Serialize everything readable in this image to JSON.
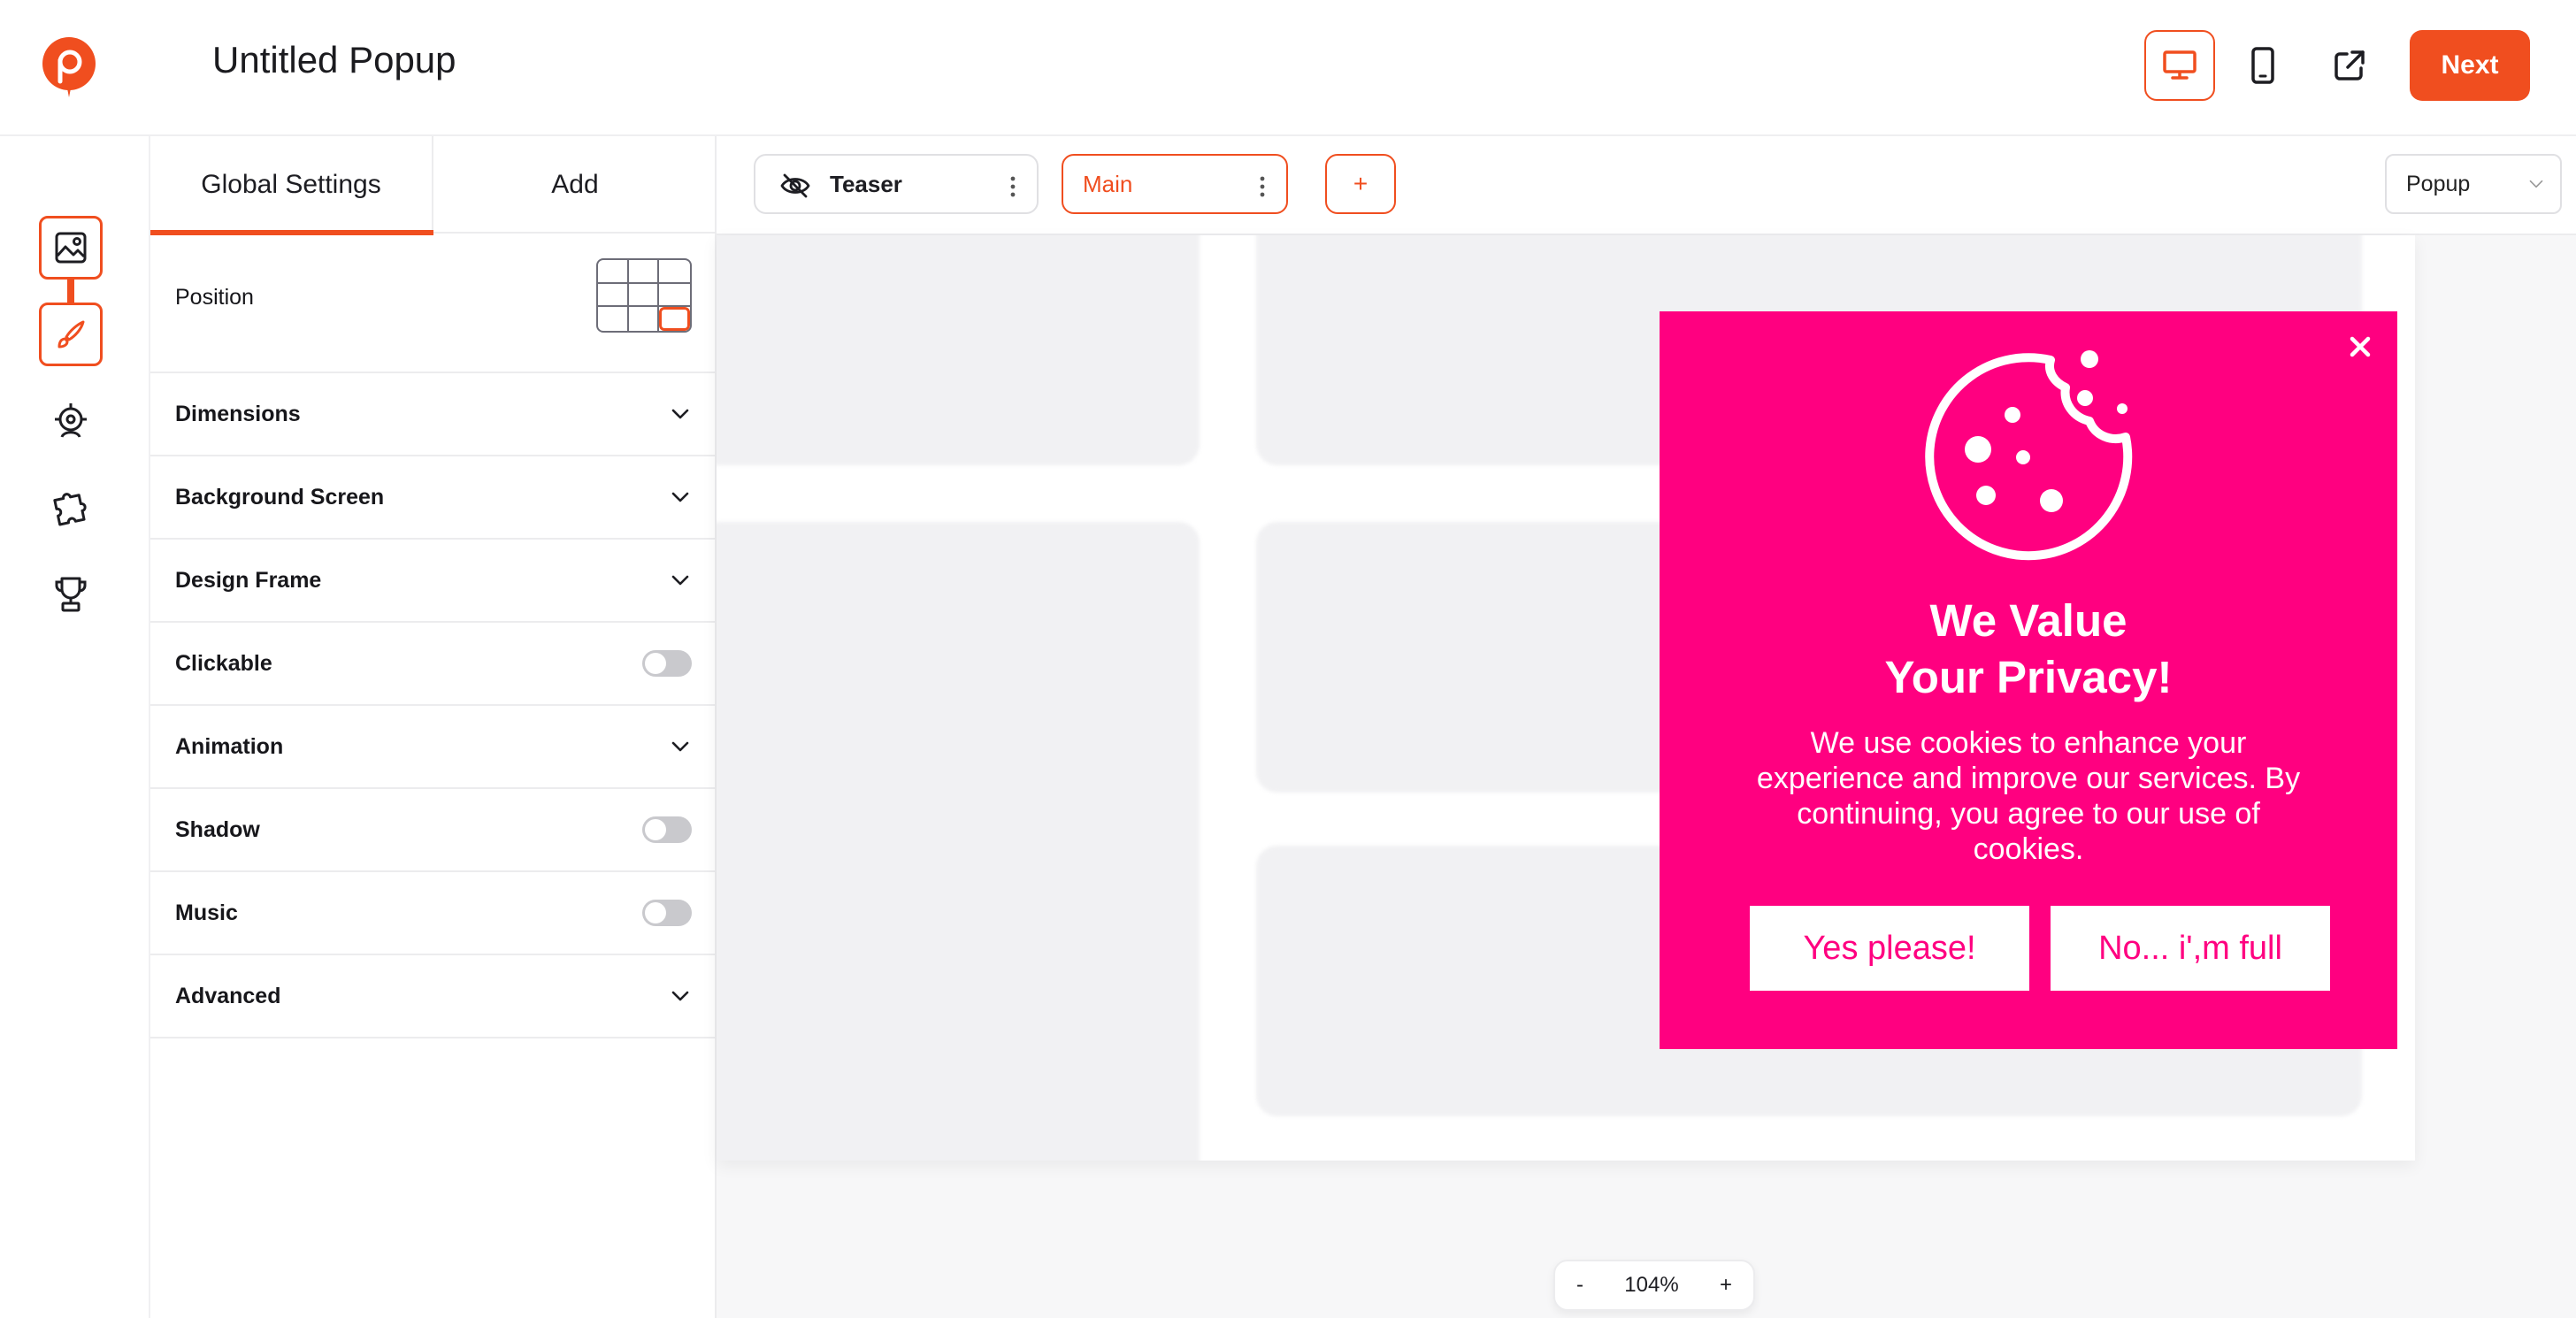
{
  "header": {
    "title": "Untitled Popup",
    "next_label": "Next"
  },
  "colors": {
    "accent": "#f04e1f",
    "popup_background": "#ff0080"
  },
  "rail": {
    "icons": [
      "image-icon",
      "brush-icon",
      "target-icon",
      "puzzle-icon",
      "trophy-icon"
    ]
  },
  "panel": {
    "tabs": [
      "Global Settings",
      "Add"
    ],
    "position_label": "Position",
    "rows": [
      {
        "label": "Dimensions",
        "control": "chevron"
      },
      {
        "label": "Background Screen",
        "control": "chevron"
      },
      {
        "label": "Design Frame",
        "control": "chevron"
      },
      {
        "label": "Clickable",
        "control": "toggle"
      },
      {
        "label": "Animation",
        "control": "chevron"
      },
      {
        "label": "Shadow",
        "control": "toggle"
      },
      {
        "label": "Music",
        "control": "toggle"
      },
      {
        "label": "Advanced",
        "control": "chevron"
      }
    ]
  },
  "steps": {
    "teaser": "Teaser",
    "main": "Main",
    "add": "+",
    "type_select": "Popup"
  },
  "popup": {
    "heading_line1": "We Value",
    "heading_line2": "Your Privacy!",
    "body": "We use cookies to enhance your experience and improve our services. By continuing, you agree to our use of cookies.",
    "yes_button": "Yes please!",
    "no_button": "No... i',m full"
  },
  "zoom": {
    "minus": "-",
    "value": "104%",
    "plus": "+"
  }
}
